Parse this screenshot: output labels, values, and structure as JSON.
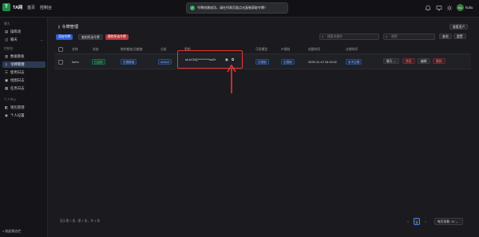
{
  "app": {
    "logo": "T",
    "title": "TA网"
  },
  "nav": [
    {
      "label": "首页"
    },
    {
      "label": "控制台"
    }
  ],
  "toast": {
    "text": "令牌创建成功，请在列表页面点击复制获取令牌！",
    "icon": "check-circle-icon"
  },
  "topbar_icons": [
    "bell-icon",
    "monitor-icon",
    "sun-icon"
  ],
  "user": {
    "avatar": "hu",
    "name": "huhu"
  },
  "sidebar": {
    "groups": [
      {
        "label": "聊天",
        "items": [
          {
            "label": "操练场",
            "icon": "layers-icon"
          },
          {
            "label": "聊天",
            "icon": "chat-icon"
          }
        ]
      },
      {
        "label": "控制台",
        "items": [
          {
            "label": "数据看板",
            "icon": "chart-icon"
          },
          {
            "label": "令牌管理",
            "icon": "key-icon",
            "active": true
          },
          {
            "label": "使用日志",
            "icon": "list-icon"
          },
          {
            "label": "绘图日志",
            "icon": "image-icon"
          },
          {
            "label": "任务日志",
            "icon": "task-icon"
          }
        ]
      },
      {
        "label": "个人中心",
        "items": [
          {
            "label": "钱包管理",
            "icon": "wallet-icon"
          },
          {
            "label": "个人设置",
            "icon": "user-icon"
          }
        ]
      }
    ],
    "collapse": "收起侧边栏"
  },
  "main": {
    "title": "令牌管理",
    "docs_button": "查看用户",
    "actions": {
      "add": "添加令牌",
      "copy": "复制所选令牌",
      "delete": "删除所选令牌"
    },
    "search": {
      "name_placeholder": "搜索关键字",
      "key_placeholder": "密钥",
      "query": "查询",
      "reset": "重置"
    },
    "columns": [
      "名称",
      "状态",
      "剩余额度/总额度",
      "分组",
      "密钥",
      "可用模型",
      "IP限制",
      "创建时间",
      "过期时间"
    ],
    "rows": [
      {
        "name": "huhu",
        "status": "已启用",
        "quota": "无限额度",
        "group": "default",
        "key": "sk-hCNQ**********suEt",
        "models": "无限制",
        "ip": "无限制",
        "created": "2025-11-12 16:13:42",
        "expire": "永不过期",
        "ops": {
          "chat": "聊天",
          "disable": "禁用",
          "edit": "编辑",
          "delete": "删除"
        }
      }
    ],
    "footer": "显示第 1 条 - 第 1 条，共 1 条",
    "pagination": {
      "current": "1",
      "page_size": "每页条数: 10"
    }
  }
}
